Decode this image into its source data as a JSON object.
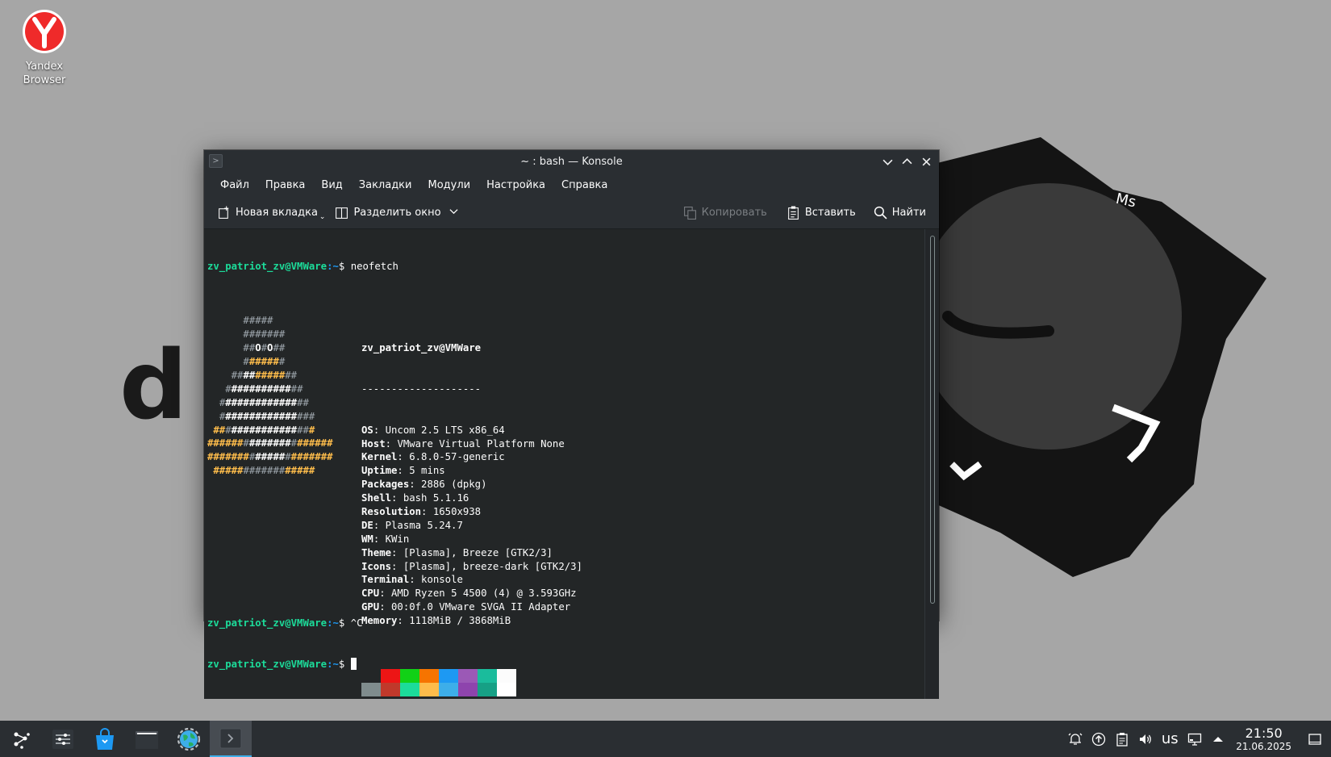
{
  "desktop": {
    "icons": [
      {
        "label": "Yandex Browser",
        "icon": "yandex-browser-icon"
      }
    ],
    "wallpaper_text": [
      "d",
      "Ms"
    ]
  },
  "window": {
    "title": "~ : bash — Konsole",
    "menu": [
      "Файл",
      "Правка",
      "Вид",
      "Закладки",
      "Модули",
      "Настройка",
      "Справка"
    ],
    "toolbar": {
      "new_tab": "Новая вкладка",
      "split": "Разделить окно",
      "copy": "Копировать",
      "paste": "Вставить",
      "find": "Найти"
    }
  },
  "terminal": {
    "user_host": "zv_patriot_zv@VMWare",
    "path": ":~",
    "dollar": "$",
    "command": " neofetch",
    "header": "zv_patriot_zv@VMWare",
    "separator": "--------------------",
    "info": [
      {
        "key": "OS",
        "value": "Uncom 2.5 LTS x86_64"
      },
      {
        "key": "Host",
        "value": "VMware Virtual Platform None"
      },
      {
        "key": "Kernel",
        "value": "6.8.0-57-generic"
      },
      {
        "key": "Uptime",
        "value": "5 mins"
      },
      {
        "key": "Packages",
        "value": "2886 (dpkg)"
      },
      {
        "key": "Shell",
        "value": "bash 5.1.16"
      },
      {
        "key": "Resolution",
        "value": "1650x938"
      },
      {
        "key": "DE",
        "value": "Plasma 5.24.7"
      },
      {
        "key": "WM",
        "value": "KWin"
      },
      {
        "key": "Theme",
        "value": "[Plasma], Breeze [GTK2/3]"
      },
      {
        "key": "Icons",
        "value": "[Plasma], breeze-dark [GTK2/3]"
      },
      {
        "key": "Terminal",
        "value": "konsole"
      },
      {
        "key": "CPU",
        "value": "AMD Ryzen 5 4500 (4) @ 3.593GHz"
      },
      {
        "key": "GPU",
        "value": "00:0f.0 VMware SVGA II Adapter"
      },
      {
        "key": "Memory",
        "value": "1118MiB / 3868MiB"
      }
    ],
    "logo": [
      [
        [
          "      ",
          ""
        ],
        [
          "#####",
          "g"
        ]
      ],
      [
        [
          "      ",
          ""
        ],
        [
          "#######",
          "g"
        ]
      ],
      [
        [
          "      ",
          ""
        ],
        [
          "##",
          "g"
        ],
        [
          "O",
          "w"
        ],
        [
          "#",
          "g"
        ],
        [
          "O",
          "w"
        ],
        [
          "##",
          "g"
        ]
      ],
      [
        [
          "      ",
          ""
        ],
        [
          "#",
          "g"
        ],
        [
          "#####",
          "y"
        ],
        [
          "#",
          "g"
        ]
      ],
      [
        [
          "    ",
          ""
        ],
        [
          "##",
          "g"
        ],
        [
          "##",
          "w"
        ],
        [
          "#####",
          "y"
        ],
        [
          "##",
          "g"
        ]
      ],
      [
        [
          "   ",
          ""
        ],
        [
          "#",
          "g"
        ],
        [
          "##########",
          "w"
        ],
        [
          "##",
          "g"
        ]
      ],
      [
        [
          "  ",
          ""
        ],
        [
          "#",
          "g"
        ],
        [
          "############",
          "w"
        ],
        [
          "##",
          "g"
        ]
      ],
      [
        [
          "  ",
          ""
        ],
        [
          "#",
          "g"
        ],
        [
          "############",
          "w"
        ],
        [
          "###",
          "g"
        ]
      ],
      [
        [
          " ",
          ""
        ],
        [
          "##",
          "y"
        ],
        [
          "#",
          "g"
        ],
        [
          "###########",
          "w"
        ],
        [
          "##",
          "g"
        ],
        [
          "#",
          "y"
        ]
      ],
      [
        [
          "",
          ""
        ],
        [
          "######",
          "y"
        ],
        [
          "#",
          "g"
        ],
        [
          "#######",
          "w"
        ],
        [
          "#",
          "g"
        ],
        [
          "######",
          "y"
        ]
      ],
      [
        [
          "",
          ""
        ],
        [
          "#######",
          "y"
        ],
        [
          "#",
          "g"
        ],
        [
          "#####",
          "w"
        ],
        [
          "#",
          "g"
        ],
        [
          "#######",
          "y"
        ]
      ],
      [
        [
          " ",
          ""
        ],
        [
          "#####",
          "y"
        ],
        [
          "#######",
          "g"
        ],
        [
          "#####",
          "y"
        ]
      ]
    ],
    "palette_top": [
      "#232627",
      "#ed1515",
      "#11d116",
      "#f67400",
      "#1d99f3",
      "#9b59b6",
      "#1abc9c",
      "#fcfcfc"
    ],
    "palette_bottom": [
      "#7f8c8d",
      "#c0392b",
      "#1cdc9a",
      "#fdbc4b",
      "#3daee9",
      "#8e44ad",
      "#16a085",
      "#ffffff"
    ],
    "interrupt": " ^C"
  },
  "taskbar": {
    "keyboard_layout": "us",
    "time": "21:50",
    "date": "21.06.2025",
    "tasks": [
      "application-launcher-icon",
      "system-settings-icon",
      "discover-store-icon",
      "dolphin-file-manager-icon",
      "browser-globe-icon",
      "konsole-icon"
    ],
    "tray": [
      "notifications-icon",
      "updates-icon",
      "clipboard-icon",
      "volume-icon",
      "network-icon",
      "show-hidden-icons-icon",
      "show-desktop-icon"
    ]
  },
  "colors": {
    "accent": "#3daee9",
    "prompt_user": "#1cdc9a",
    "prompt_path": "#1d99f3",
    "window_bg": "#232629",
    "desktop_bg": "#a6a6a6"
  }
}
